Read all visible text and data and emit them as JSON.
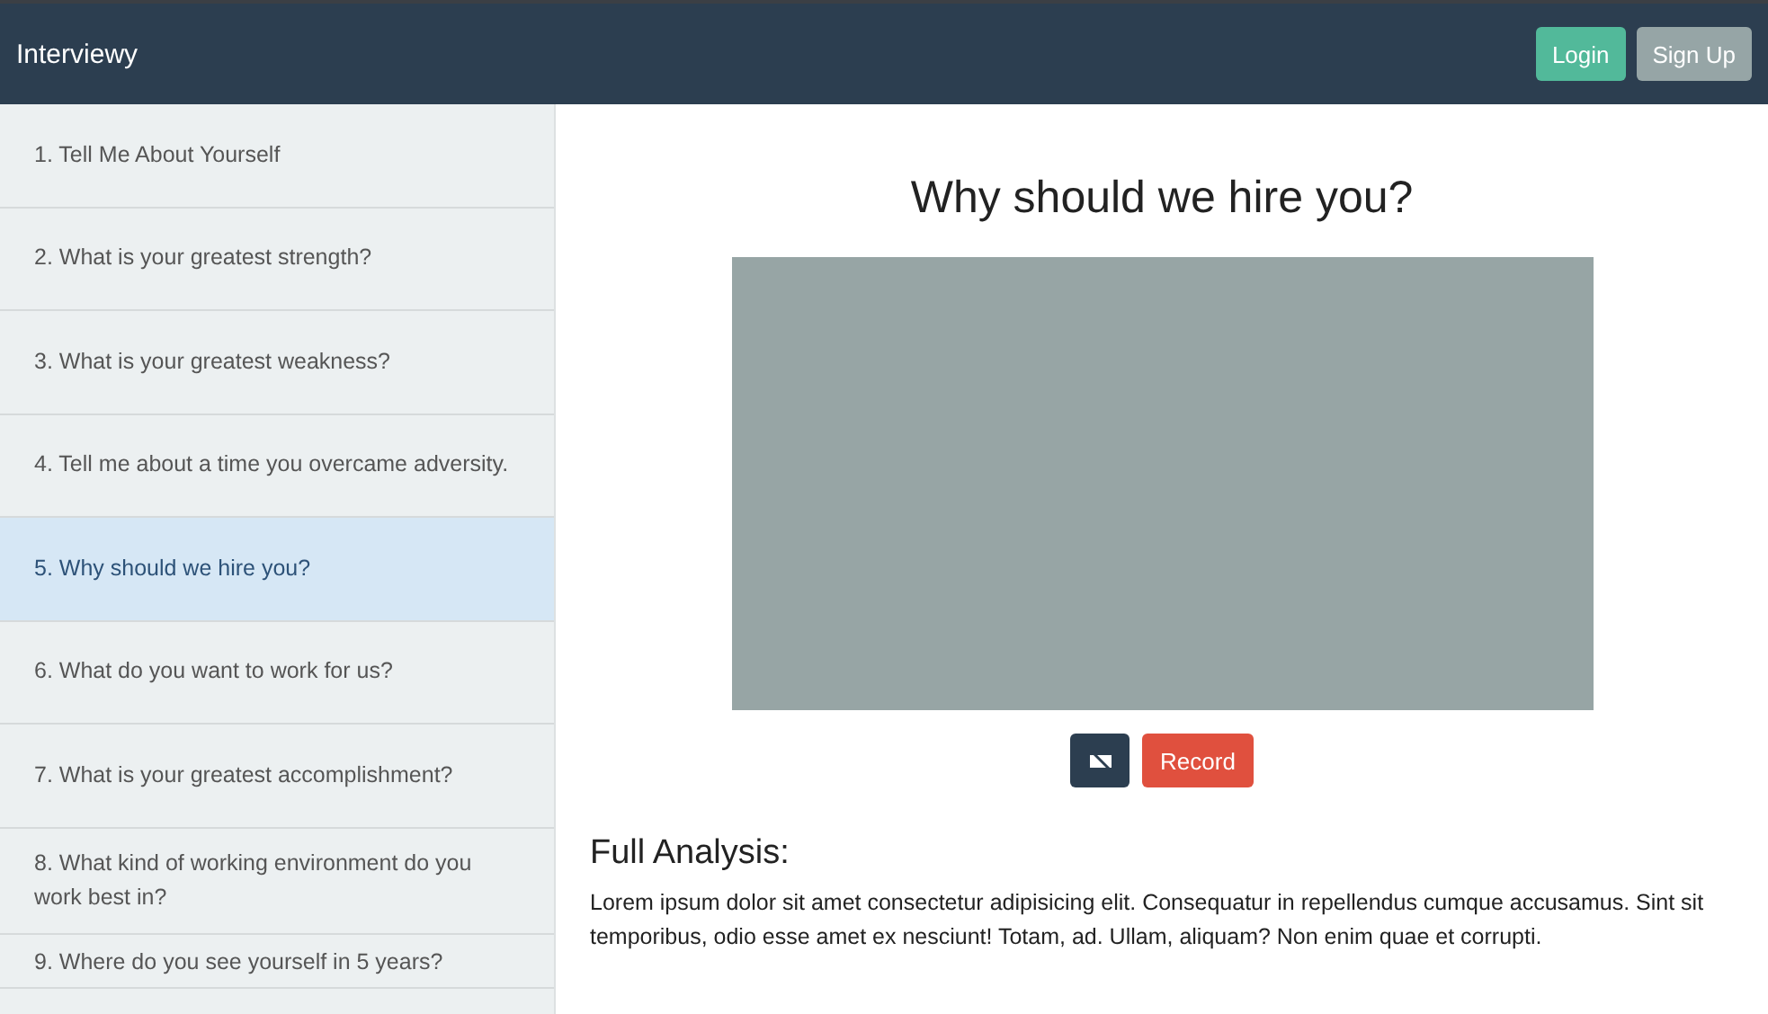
{
  "navbar": {
    "brand": "Interviewy",
    "buttons": [
      {
        "label": "Login",
        "kind": "primary"
      },
      {
        "label": "Sign Up",
        "kind": "secondary"
      }
    ]
  },
  "sidebar": {
    "items": [
      {
        "label": "1. Tell Me About Yourself",
        "selected": false
      },
      {
        "label": "2. What is your greatest strength?",
        "selected": false
      },
      {
        "label": "3. What is your greatest weakness?",
        "selected": false
      },
      {
        "label": "4. Tell me about a time you overcame adversity.",
        "selected": false
      },
      {
        "label": "5. Why should we hire you?",
        "selected": true
      },
      {
        "label": "6. What do you want to work for us?",
        "selected": false
      },
      {
        "label": "7. What is your greatest accomplishment?",
        "selected": false
      },
      {
        "label": "8. What kind of working environment do you work best in?",
        "selected": false
      },
      {
        "label": "9. Where do you see yourself in 5 years?",
        "selected": false
      }
    ]
  },
  "main": {
    "question": "Why should we hire you?",
    "record_button": "Record",
    "analysis": {
      "heading": "Full Analysis:",
      "text": "Lorem ipsum dolor sit amet consectetur adipisicing elit. Consequatur in repellendus cumque accusamus. Sint sit temporibus, odio esse amet ex nesciunt! Totam, ad. Ullam, aliquam? Non enim quae et corrupti."
    }
  }
}
